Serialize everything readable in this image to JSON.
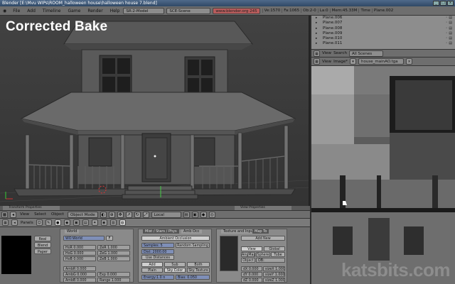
{
  "titlebar": {
    "text": "Blender [E:\\Mvu WIPs\\ROOM_halloween house\\halloween house 7.blend]",
    "min": "_",
    "max": "□",
    "close": "x"
  },
  "menubar": {
    "items": [
      "File",
      "Add",
      "Timeline",
      "Game",
      "Render",
      "Help"
    ],
    "screen": "SR:2-Model",
    "scene": "SCE:Scene",
    "url": "www.blender.org 245",
    "stats": {
      "ve": "Ve:1570",
      "fa": "Fa:1065",
      "ob": "Ob:2-0",
      "la": "La:0",
      "mem": "Mem:45.33M",
      "time": "Time",
      "plane": "Plane.002"
    }
  },
  "viewport": {
    "label": "Corrected Bake",
    "view_label": "View",
    "select_label": "Select",
    "object_label": "Object",
    "mode": "Object Mode",
    "orientation": "Local",
    "left_tab": "Transform Properties",
    "right_tab": "View Properties"
  },
  "outliner": {
    "rows": [
      "Plane.006",
      "Plane.007",
      "Plane.008",
      "Plane.009",
      "Plane.010",
      "Plane.011"
    ],
    "view_label": "View",
    "search_label": "Search",
    "scene_select": "All Scenes"
  },
  "image_editor": {
    "view_label": "View",
    "image_label": "Image*",
    "image_name": "house_mainAO.tga",
    "watermark": "katsbits.com"
  },
  "buttons": {
    "panels_label": "Panels",
    "preview_buttons": [
      "Real",
      "Blend",
      "Paper"
    ],
    "world_tab": "World",
    "world_name": "WO:World",
    "world_fields": [
      "HoR 0.000",
      "HoG 0.000",
      "HoB 0.000",
      "ZeR 1.000",
      "ZeG 1.000",
      "ZeB 1.000"
    ],
    "amb_fields": [
      "AmbR 0.000",
      "AmbG 0.000",
      "AmbB 0.000",
      "Exp 0.000",
      "Range 1.000"
    ],
    "middle_tabs": [
      "Mist / Stars / Phys",
      "Amb Occ"
    ],
    "ao_header": "Ambient Occlusion",
    "ao_fields": [
      "Samples: 5",
      "Random Sampling",
      "Dist: 2000.00",
      "Use Distances",
      "Energy:1.0 n",
      "Bias: 0.050"
    ],
    "ao_modes": [
      "Add",
      "Sub",
      "Both"
    ],
    "ao_colors": [
      "Plain",
      "Sky Color",
      "Sky Texture"
    ],
    "right_tabs": [
      "Texture and Input",
      "Map To"
    ],
    "add_new": "Add New",
    "map_buttons": [
      "View",
      "Global",
      "AngMap",
      "Sphere",
      "Tube",
      "Object",
      "OB:"
    ],
    "ofs_fields": [
      "dX 0.000",
      "dY 0.000",
      "dZ 0.000",
      "sizeX 1.000",
      "sizeY 1.000",
      "sizeZ 1.000"
    ]
  }
}
